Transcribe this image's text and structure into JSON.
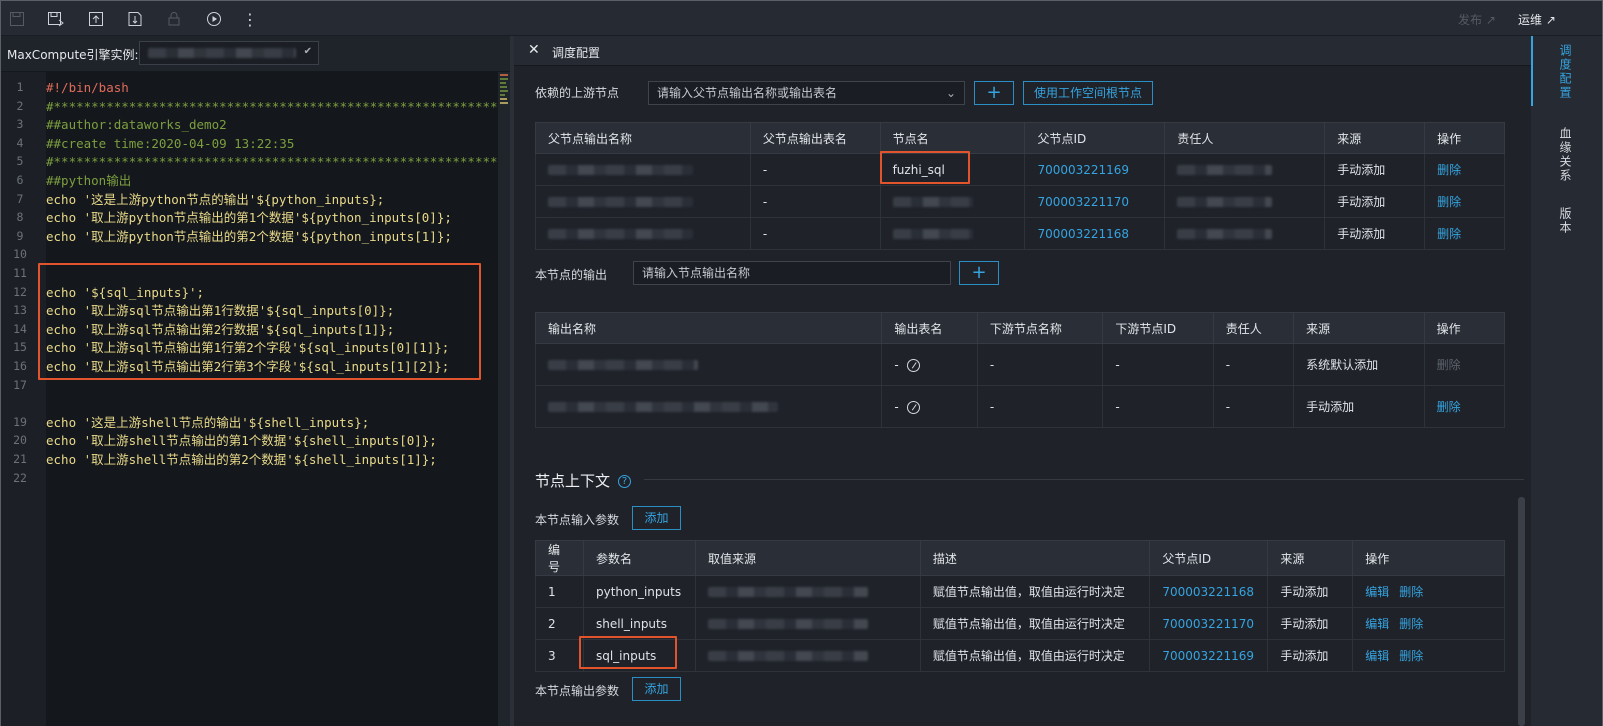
{
  "toolbar": {
    "publish": "发布 ↗",
    "ops": "运维 ↗"
  },
  "engine": {
    "label": "MaxCompute引擎实例:"
  },
  "code": [
    {
      "n": "1",
      "text": "#!/bin/bash",
      "cls": "c-shebang"
    },
    {
      "n": "2",
      "text": "#**********************************************************************",
      "cls": "c-comment"
    },
    {
      "n": "3",
      "text": "##author:dataworks_demo2",
      "cls": "c-comment"
    },
    {
      "n": "4",
      "text": "##create time:2020-04-09 13:22:35",
      "cls": "c-comment"
    },
    {
      "n": "5",
      "text": "#**********************************************************************",
      "cls": "c-comment"
    },
    {
      "n": "6",
      "text": "##python输出",
      "cls": "c-comment"
    },
    {
      "n": "7",
      "text": "echo '这是上游python节点的输出'${python_inputs};",
      "cls": "c-plain"
    },
    {
      "n": "8",
      "text": "echo '取上游python节点输出的第1个数据'${python_inputs[0]};",
      "cls": "c-plain"
    },
    {
      "n": "9",
      "text": "echo '取上游python节点输出的第2个数据'${python_inputs[1]};",
      "cls": "c-plain"
    },
    {
      "n": "10",
      "text": "",
      "cls": "c-plain"
    },
    {
      "n": "11",
      "text": "",
      "cls": "c-plain"
    },
    {
      "n": "12",
      "text": "echo '${sql_inputs}';",
      "cls": "c-plain"
    },
    {
      "n": "13",
      "text": "echo '取上游sql节点输出第1行数据'${sql_inputs[0]};",
      "cls": "c-plain"
    },
    {
      "n": "14",
      "text": "echo '取上游sql节点输出第2行数据'${sql_inputs[1]};",
      "cls": "c-plain"
    },
    {
      "n": "15",
      "text": "echo '取上游sql节点输出第1行第2个字段'${sql_inputs[0][1]};",
      "cls": "c-plain"
    },
    {
      "n": "16",
      "text": "echo '取上游sql节点输出第2行第3个字段'${sql_inputs[1][2]};",
      "cls": "c-plain"
    },
    {
      "n": "17",
      "text": "",
      "cls": "c-plain"
    },
    {
      "n": "",
      "text": "",
      "cls": "c-plain"
    },
    {
      "n": "19",
      "text": "echo '这是上游shell节点的输出'${shell_inputs};",
      "cls": "c-plain"
    },
    {
      "n": "20",
      "text": "echo '取上游shell节点输出的第1个数据'${shell_inputs[0]};",
      "cls": "c-plain"
    },
    {
      "n": "21",
      "text": "echo '取上游shell节点输出的第2个数据'${shell_inputs[1]};",
      "cls": "c-plain"
    },
    {
      "n": "22",
      "text": "",
      "cls": "c-plain"
    }
  ],
  "panel": {
    "title": "调度配置",
    "upstream_label": "依赖的上游节点",
    "upstream_placeholder": "请输入父节点输出名称或输出表名",
    "use_root_btn": "使用工作空间根节点",
    "parents_headers": [
      "父节点输出名称",
      "父节点输出表名",
      "节点名",
      "父节点ID",
      "责任人",
      "来源",
      "操作"
    ],
    "parents_rows": [
      {
        "table": "-",
        "node": "fuzhi_sql",
        "id": "700003221169",
        "source": "手动添加",
        "op": "删除"
      },
      {
        "table": "-",
        "node": "",
        "id": "700003221170",
        "source": "手动添加",
        "op": "删除"
      },
      {
        "table": "-",
        "node": "",
        "id": "700003221168",
        "source": "手动添加",
        "op": "删除"
      }
    ],
    "output_label": "本节点的输出",
    "output_placeholder": "请输入节点输出名称",
    "outputs_headers": [
      "输出名称",
      "输出表名",
      "下游节点名称",
      "下游节点ID",
      "责任人",
      "来源",
      "操作"
    ],
    "outputs_rows": [
      {
        "table": "-",
        "down_name": "-",
        "down_id": "-",
        "owner": "-",
        "source": "系统默认添加",
        "op": "删除",
        "op_disabled": true
      },
      {
        "table": "-",
        "down_name": "-",
        "down_id": "-",
        "owner": "-",
        "source": "手动添加",
        "op": "删除",
        "op_disabled": false
      }
    ],
    "context_title": "节点上下文",
    "input_params_label": "本节点输入参数",
    "add_btn": "添加",
    "params_headers": [
      "编号",
      "参数名",
      "取值来源",
      "描述",
      "父节点ID",
      "来源",
      "操作"
    ],
    "params_rows": [
      {
        "no": "1",
        "name": "python_inputs",
        "desc": "赋值节点输出值，取值由运行时决定",
        "pid": "700003221168",
        "source": "手动添加",
        "edit": "编辑",
        "del": "删除"
      },
      {
        "no": "2",
        "name": "shell_inputs",
        "desc": "赋值节点输出值，取值由运行时决定",
        "pid": "700003221170",
        "source": "手动添加",
        "edit": "编辑",
        "del": "删除"
      },
      {
        "no": "3",
        "name": "sql_inputs",
        "desc": "赋值节点输出值，取值由运行时决定",
        "pid": "700003221169",
        "source": "手动添加",
        "edit": "编辑",
        "del": "删除"
      }
    ],
    "output_params_label": "本节点输出参数"
  },
  "sidetabs": [
    "调度配置",
    "血缘关系",
    "版本"
  ]
}
